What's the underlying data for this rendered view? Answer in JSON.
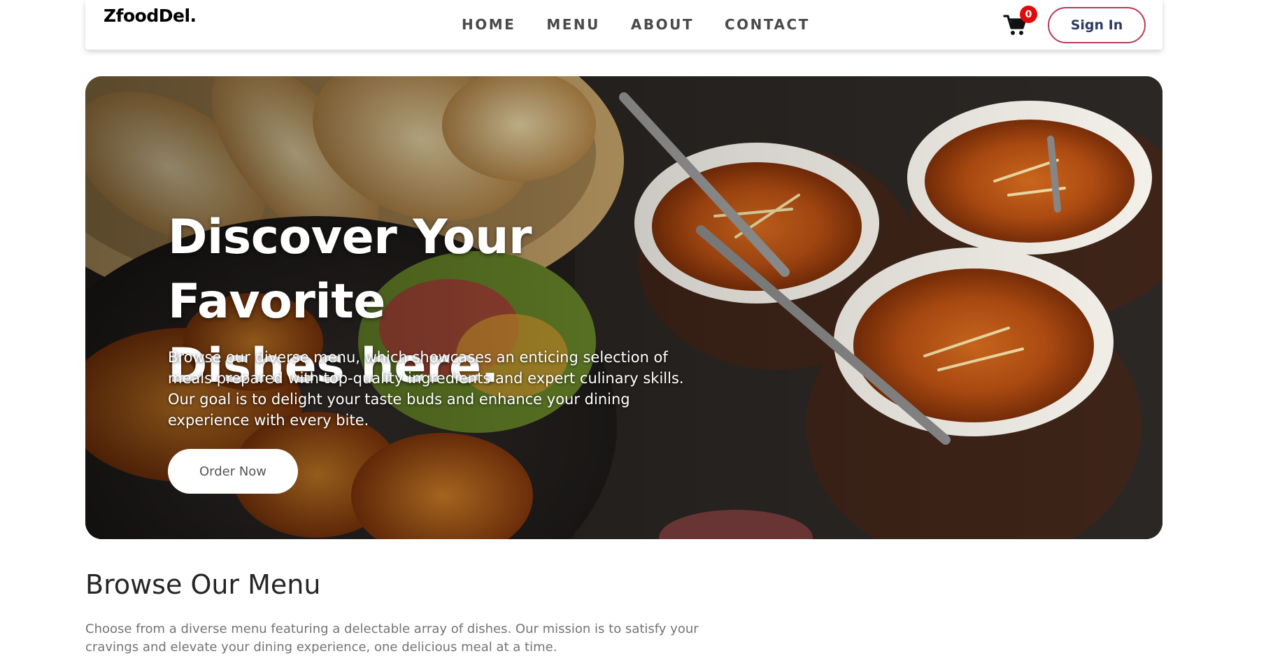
{
  "brand": {
    "logo_main": "ZfoodDel.",
    "color": "#e3214f"
  },
  "nav": {
    "links": [
      "HOME",
      "MENU",
      "ABOUT",
      "CONTACT"
    ],
    "cart_count": "0",
    "signin_label": "Sign In"
  },
  "hero": {
    "title_line1": "Discover Your Favorite",
    "title_line2": "Dishes here.",
    "description": "Browse our diverse menu, which showcases an enticing selection of meals prepared with top-quality ingredients and expert culinary skills. Our goal is to delight your taste buds and enhance your dining experience with every bite.",
    "cta_label": "Order Now"
  },
  "menu": {
    "heading": "Browse Our Menu",
    "description": "Choose from a diverse menu featuring a delectable array of dishes. Our mission is to satisfy your cravings and elevate your dining experience, one delicious meal at a time."
  },
  "icons": {
    "cart": "shopping-cart-icon"
  },
  "colors": {
    "badge": "#e00c0c",
    "signin_border": "#b8395a",
    "signin_text": "#2e3a66"
  }
}
